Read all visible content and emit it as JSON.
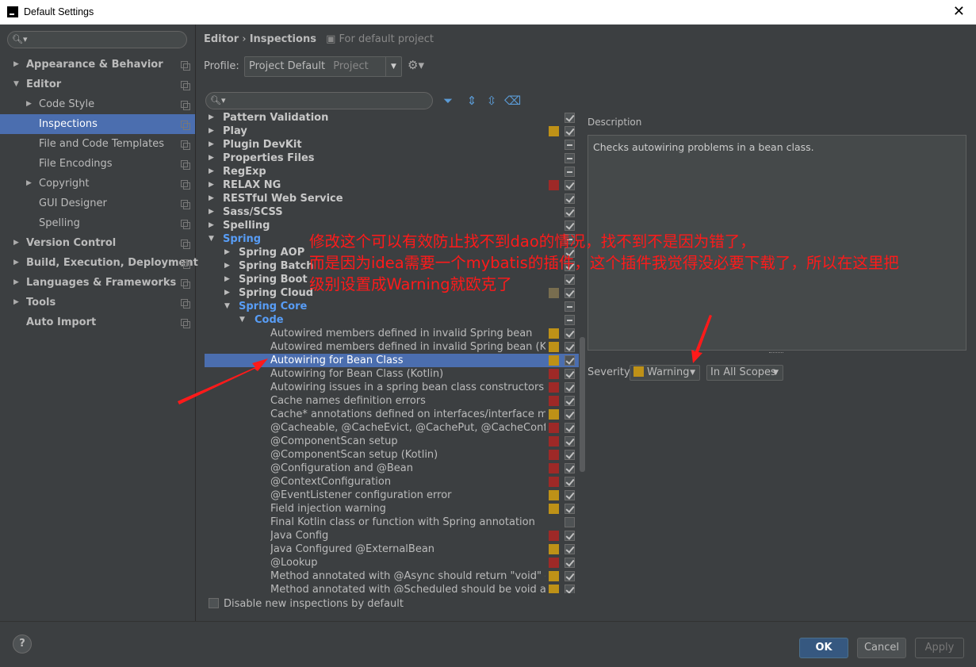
{
  "window": {
    "title": "Default Settings",
    "close": "✕"
  },
  "sidebar": {
    "search_placeholder": "",
    "items": [
      {
        "label": "Appearance & Behavior",
        "arrow": "▶"
      },
      {
        "label": "Editor",
        "arrow": "▼"
      },
      {
        "label": "Code Style",
        "arrow": "▶"
      },
      {
        "label": "Inspections",
        "arrow": ""
      },
      {
        "label": "File and Code Templates",
        "arrow": ""
      },
      {
        "label": "File Encodings",
        "arrow": ""
      },
      {
        "label": "Copyright",
        "arrow": "▶"
      },
      {
        "label": "GUI Designer",
        "arrow": ""
      },
      {
        "label": "Spelling",
        "arrow": ""
      },
      {
        "label": "Version Control",
        "arrow": "▶"
      },
      {
        "label": "Build, Execution, Deployment",
        "arrow": "▶"
      },
      {
        "label": "Languages & Frameworks",
        "arrow": "▶"
      },
      {
        "label": "Tools",
        "arrow": "▶"
      },
      {
        "label": "Auto Import",
        "arrow": ""
      }
    ]
  },
  "header": {
    "breadcrumb_editor": "Editor",
    "breadcrumb_sep": "›",
    "breadcrumb_inspections": "Inspections",
    "project_note": "For default project"
  },
  "profile": {
    "label": "Profile:",
    "value": "Project Default",
    "scope": "Project"
  },
  "inspections": {
    "rows": [
      {
        "label": "Pattern Validation",
        "arrow": "▶",
        "kind": "group",
        "sev": "",
        "cb": "on"
      },
      {
        "label": "Play",
        "arrow": "▶",
        "kind": "group",
        "sev": "#be9117",
        "cb": "on"
      },
      {
        "label": "Plugin DevKit",
        "arrow": "▶",
        "kind": "group",
        "sev": "",
        "cb": "mix"
      },
      {
        "label": "Properties Files",
        "arrow": "▶",
        "kind": "group",
        "sev": "",
        "cb": "mix"
      },
      {
        "label": "RegExp",
        "arrow": "▶",
        "kind": "group",
        "sev": "",
        "cb": "mix"
      },
      {
        "label": "RELAX NG",
        "arrow": "▶",
        "kind": "group",
        "sev": "#9e2927",
        "cb": "on"
      },
      {
        "label": "RESTful Web Service",
        "arrow": "▶",
        "kind": "group",
        "sev": "",
        "cb": "on"
      },
      {
        "label": "Sass/SCSS",
        "arrow": "▶",
        "kind": "group",
        "sev": "",
        "cb": "on"
      },
      {
        "label": "Spelling",
        "arrow": "▶",
        "kind": "group",
        "sev": "",
        "cb": "on"
      },
      {
        "label": "Spring",
        "arrow": "▼",
        "kind": "blue",
        "sev": "",
        "cb": "mix"
      },
      {
        "label": "Spring AOP",
        "arrow": "▶",
        "kind": "group2",
        "sev": "",
        "cb": "on"
      },
      {
        "label": "Spring Batch",
        "arrow": "▶",
        "kind": "group2",
        "sev": "",
        "cb": "on"
      },
      {
        "label": "Spring Boot",
        "arrow": "▶",
        "kind": "group2",
        "sev": "",
        "cb": "on"
      },
      {
        "label": "Spring Cloud",
        "arrow": "▶",
        "kind": "group2",
        "sev": "#786d4f",
        "cb": "on"
      },
      {
        "label": "Spring Core",
        "arrow": "▼",
        "kind": "blue2",
        "sev": "",
        "cb": "mix"
      },
      {
        "label": "Code",
        "arrow": "▼",
        "kind": "blue3",
        "sev": "",
        "cb": "mix"
      },
      {
        "label": "Autowired members defined in invalid Spring bean",
        "arrow": "",
        "kind": "leaf",
        "sev": "#be9117",
        "cb": "on"
      },
      {
        "label": "Autowired members defined in invalid Spring bean (Kotlin)",
        "arrow": "",
        "kind": "leaf",
        "sev": "#be9117",
        "cb": "on"
      },
      {
        "label": "Autowiring for Bean Class",
        "arrow": "",
        "kind": "leaf",
        "sev": "#be9117",
        "cb": "on",
        "selected": true
      },
      {
        "label": "Autowiring for Bean Class (Kotlin)",
        "arrow": "",
        "kind": "leaf",
        "sev": "#9e2927",
        "cb": "on"
      },
      {
        "label": "Autowiring issues in a spring bean class constructors",
        "arrow": "",
        "kind": "leaf",
        "sev": "#9e2927",
        "cb": "on"
      },
      {
        "label": "Cache names definition errors",
        "arrow": "",
        "kind": "leaf",
        "sev": "#9e2927",
        "cb": "on"
      },
      {
        "label": "Cache* annotations defined on interfaces/interface methods",
        "arrow": "",
        "kind": "leaf",
        "sev": "#be9117",
        "cb": "on"
      },
      {
        "label": "@Cacheable, @CacheEvict, @CachePut, @CacheConfig errors",
        "arrow": "",
        "kind": "leaf",
        "sev": "#9e2927",
        "cb": "on"
      },
      {
        "label": "@ComponentScan setup",
        "arrow": "",
        "kind": "leaf",
        "sev": "#9e2927",
        "cb": "on"
      },
      {
        "label": "@ComponentScan setup (Kotlin)",
        "arrow": "",
        "kind": "leaf",
        "sev": "#9e2927",
        "cb": "on"
      },
      {
        "label": "@Configuration and @Bean",
        "arrow": "",
        "kind": "leaf",
        "sev": "#9e2927",
        "cb": "on"
      },
      {
        "label": "@ContextConfiguration",
        "arrow": "",
        "kind": "leaf",
        "sev": "#9e2927",
        "cb": "on"
      },
      {
        "label": "@EventListener configuration error",
        "arrow": "",
        "kind": "leaf",
        "sev": "#be9117",
        "cb": "on"
      },
      {
        "label": "Field injection warning",
        "arrow": "",
        "kind": "leaf",
        "sev": "#be9117",
        "cb": "on"
      },
      {
        "label": "Final Kotlin class or function with Spring annotation",
        "arrow": "",
        "kind": "leaf",
        "sev": "",
        "cb": "off"
      },
      {
        "label": "Java Config",
        "arrow": "",
        "kind": "leaf",
        "sev": "#9e2927",
        "cb": "on"
      },
      {
        "label": "Java Configured @ExternalBean",
        "arrow": "",
        "kind": "leaf",
        "sev": "#be9117",
        "cb": "on"
      },
      {
        "label": "@Lookup",
        "arrow": "",
        "kind": "leaf",
        "sev": "#9e2927",
        "cb": "on"
      },
      {
        "label": "Method annotated with @Async should return \"void\" or \"Fu",
        "arrow": "",
        "kind": "leaf",
        "sev": "#be9117",
        "cb": "on"
      },
      {
        "label": "Method annotated with @Scheduled should be void and no",
        "arrow": "",
        "kind": "leaf",
        "sev": "#be9117",
        "cb": "on"
      }
    ]
  },
  "description": {
    "label": "Description",
    "text": "Checks autowiring problems in a bean class."
  },
  "severity": {
    "label": "Severity:",
    "value": "Warning",
    "value_color": "#be9117",
    "scope": "In All Scopes"
  },
  "disable_new": {
    "label": "Disable new inspections by default"
  },
  "buttons": {
    "help": "?",
    "ok": "OK",
    "cancel": "Cancel",
    "apply": "Apply"
  },
  "annotation": {
    "line1": "修改这个可以有效防止找不到dao的情况，找不到不是因为错了，",
    "line2": "而是因为idea需要一个mybatis的插件，这个插件我觉得没必要下载了，所以在这里把",
    "line3": "级别设置成Warning就欧克了"
  }
}
